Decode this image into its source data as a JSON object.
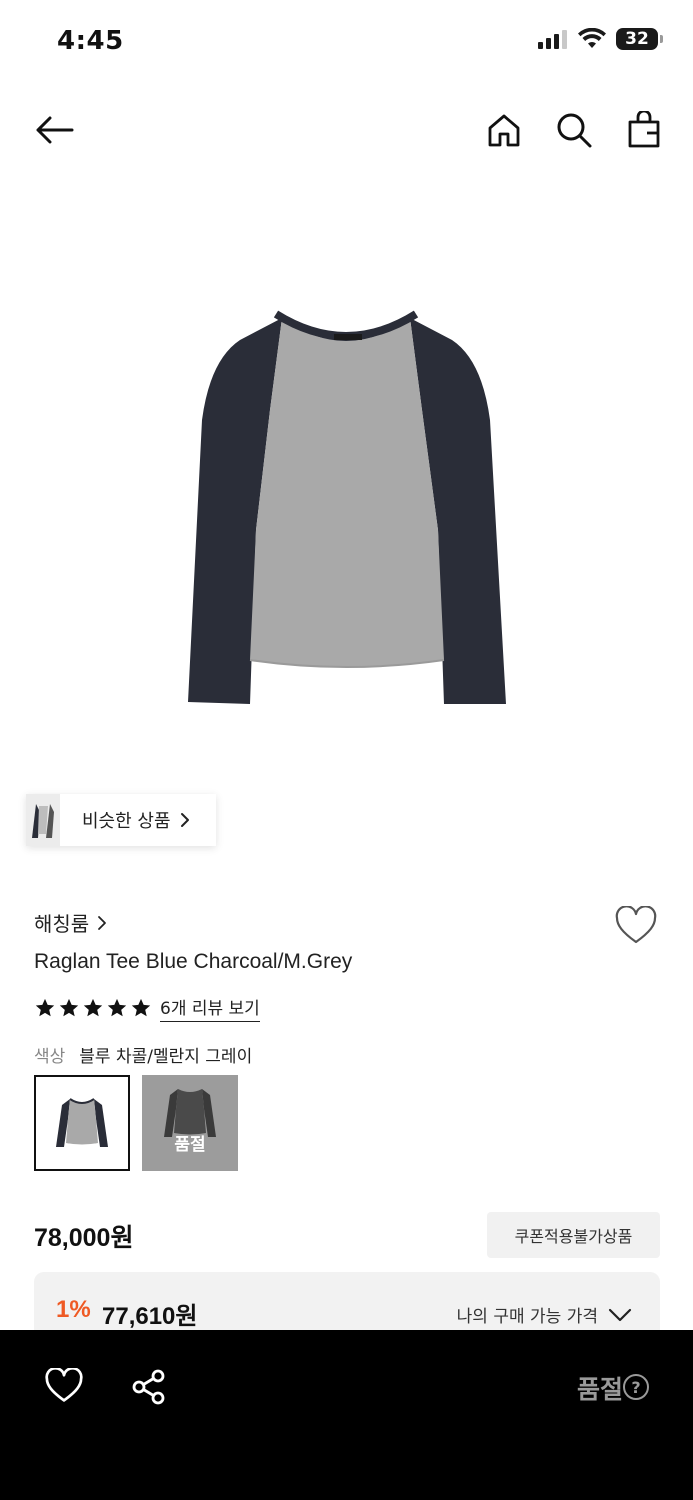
{
  "status_bar": {
    "time": "4:45",
    "battery": "32"
  },
  "top_nav": {
    "back_icon": "arrow-left-icon",
    "home_icon": "home-icon",
    "search_icon": "search-icon",
    "bag_icon": "shopping-bag-icon"
  },
  "product_image": {
    "description_icon": "raglan-tee-image",
    "colors": {
      "body": "#a9a9a9",
      "sleeves": "#2a2d38"
    }
  },
  "similar": {
    "label": "비슷한 상품"
  },
  "product": {
    "brand": "해칭룸",
    "title": "Raglan Tee Blue Charcoal/M.Grey",
    "rating_stars": 5,
    "review_link": "6개 리뷰 보기",
    "color_label": "색상",
    "color_value": "블루 차콜/멜란지 그레이",
    "swatches": [
      {
        "name": "블루 차콜/멜란지 그레이",
        "selected": true,
        "soldout": false
      },
      {
        "name": "차콜",
        "selected": false,
        "soldout": true,
        "soldout_label": "품절"
      }
    ],
    "price": "78,000원",
    "coupon_badge": "쿠폰적용불가상품",
    "discount_pct": "1%",
    "discount_price": "77,610원",
    "my_price_label": "나의 구매 가능 가격"
  },
  "bottom_bar": {
    "soldout_label": "품절",
    "help_icon": "?"
  },
  "colors": {
    "accent_discount": "#ef5a24",
    "bottom_bar_bg": "#000000",
    "soldout_text": "#9a9a9a"
  }
}
